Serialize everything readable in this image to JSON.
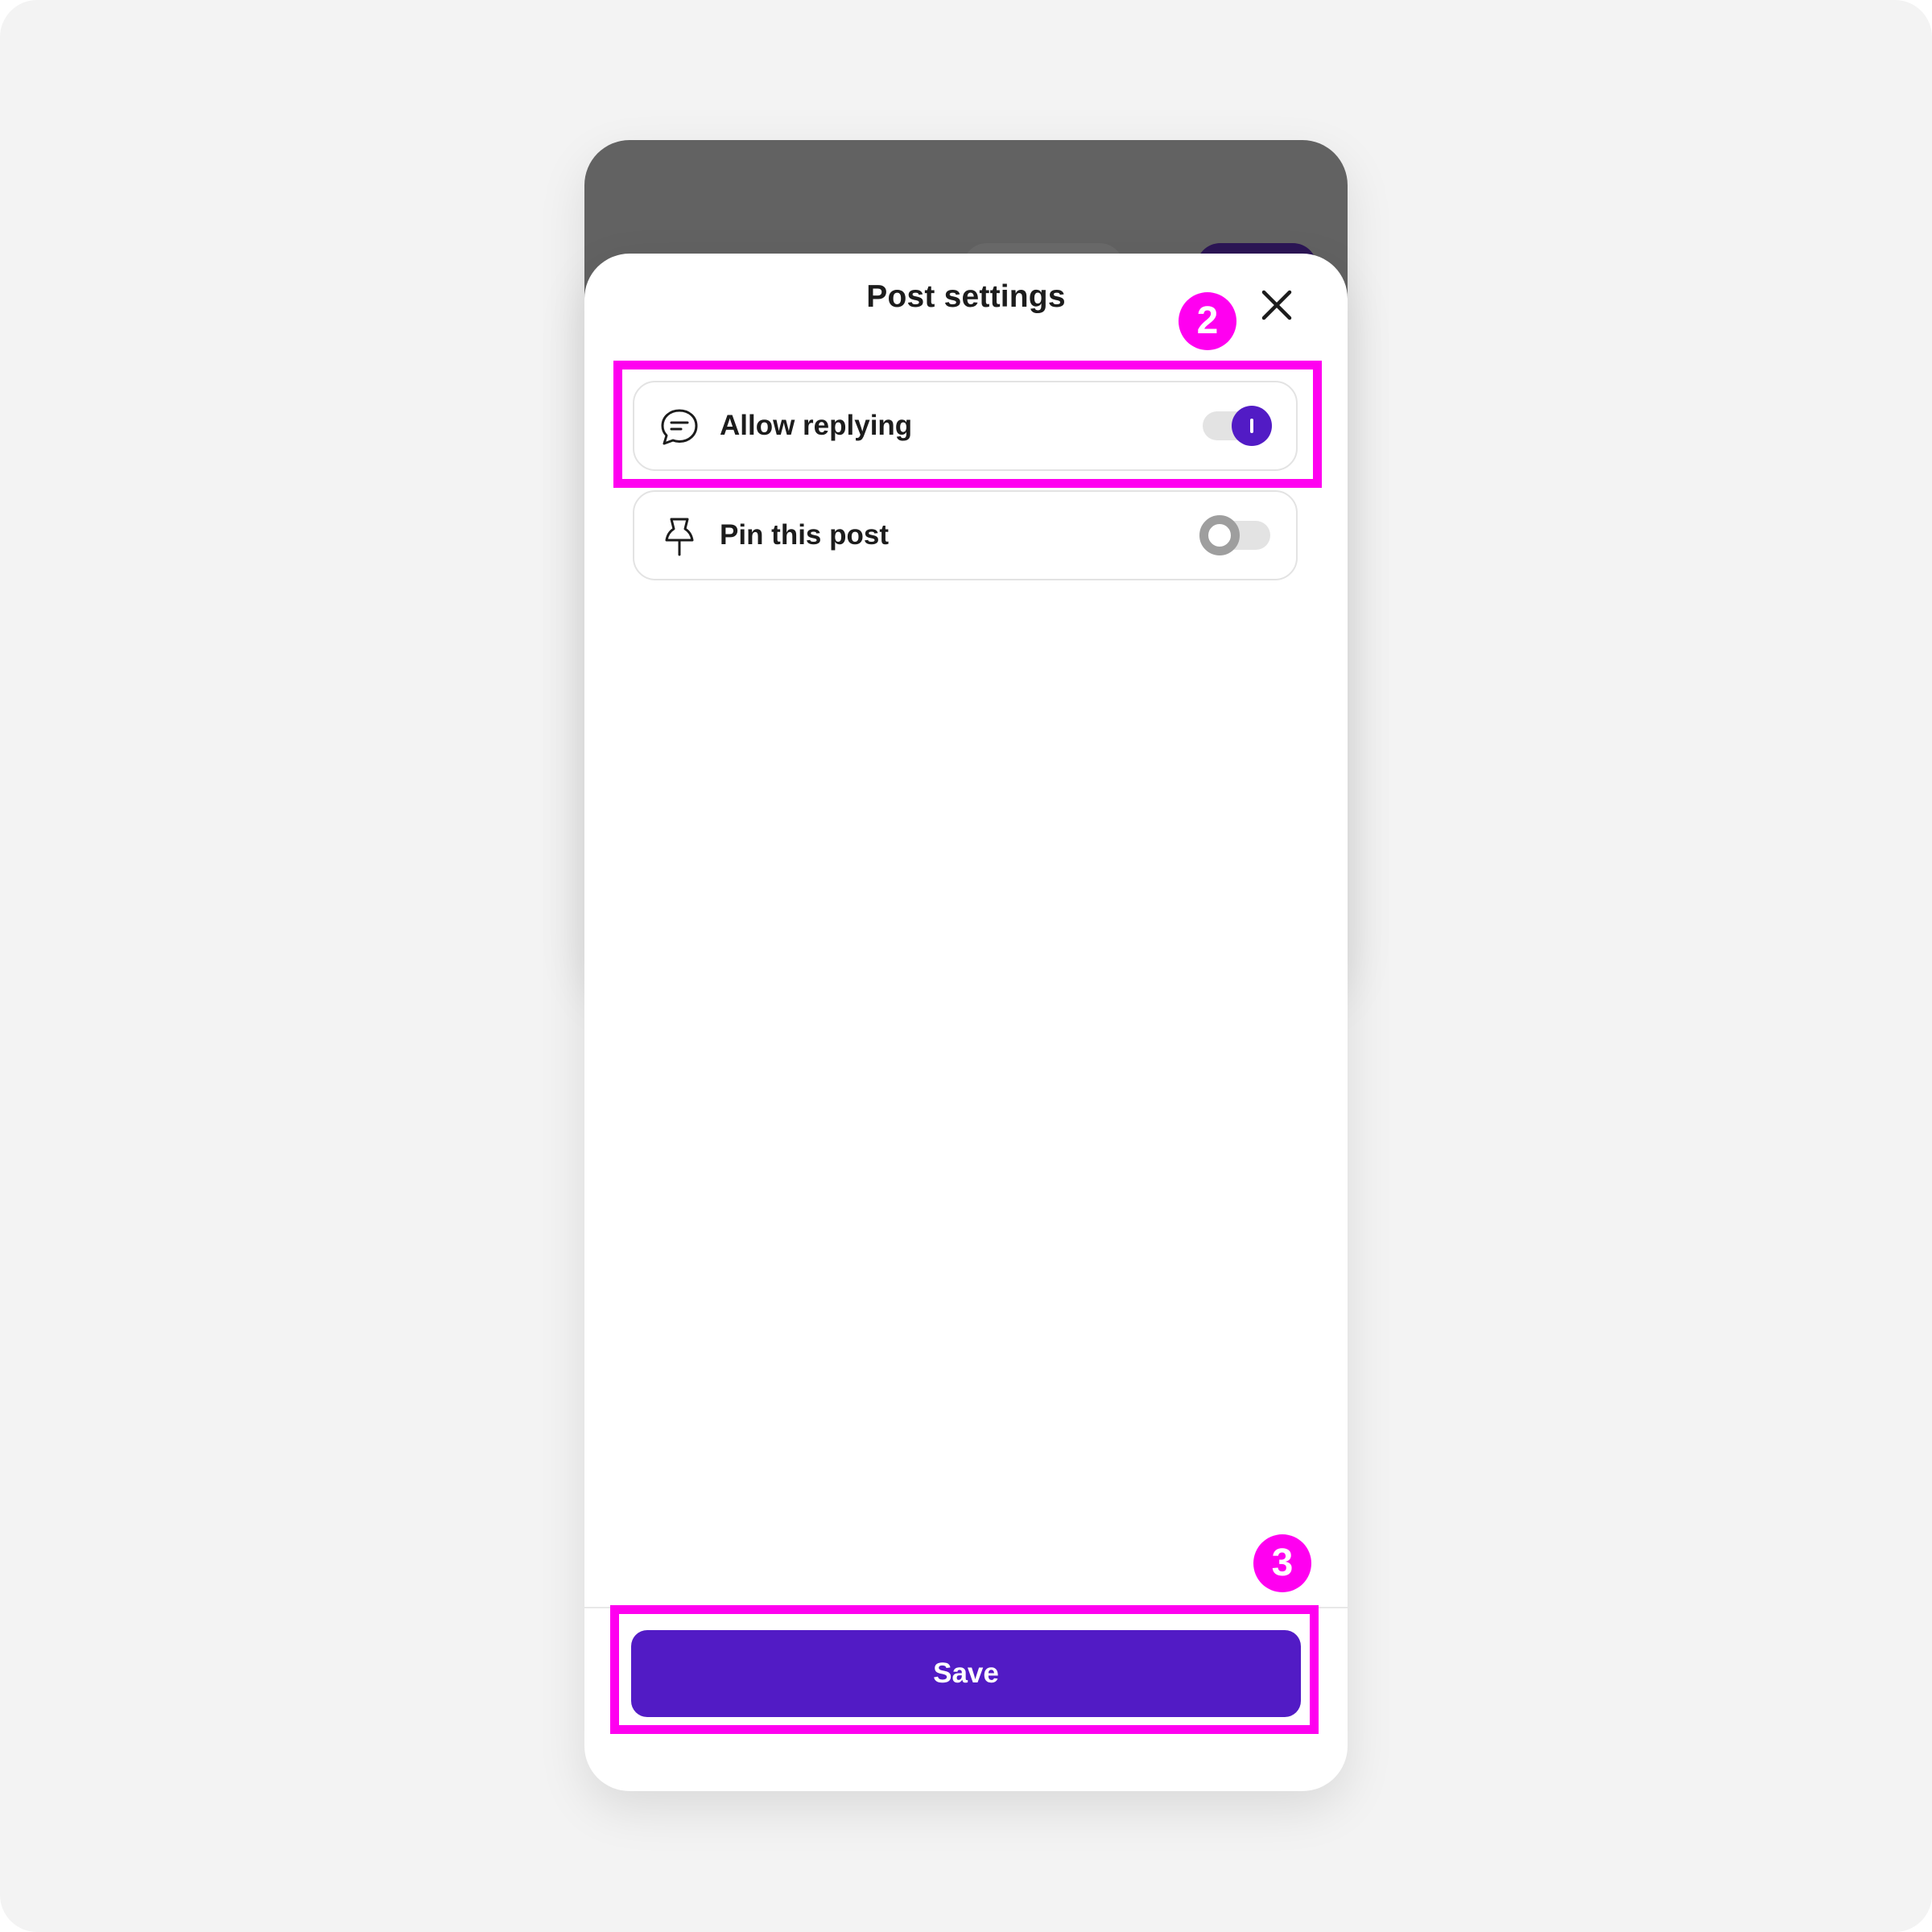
{
  "sheet": {
    "title": "Post settings",
    "close_icon": "close-icon"
  },
  "settings": [
    {
      "label": "Allow replying",
      "icon": "chat-bubble-icon",
      "enabled": true
    },
    {
      "label": "Pin this post",
      "icon": "pin-icon",
      "enabled": false
    }
  ],
  "footer": {
    "save_label": "Save"
  },
  "annotations": [
    {
      "number": "2",
      "target": "allow-replying-row"
    },
    {
      "number": "3",
      "target": "save-button"
    }
  ],
  "colors": {
    "accent": "#521bc5",
    "highlight": "#ff00f0",
    "backdrop": "#626262",
    "canvas": "#f3f3f3"
  }
}
